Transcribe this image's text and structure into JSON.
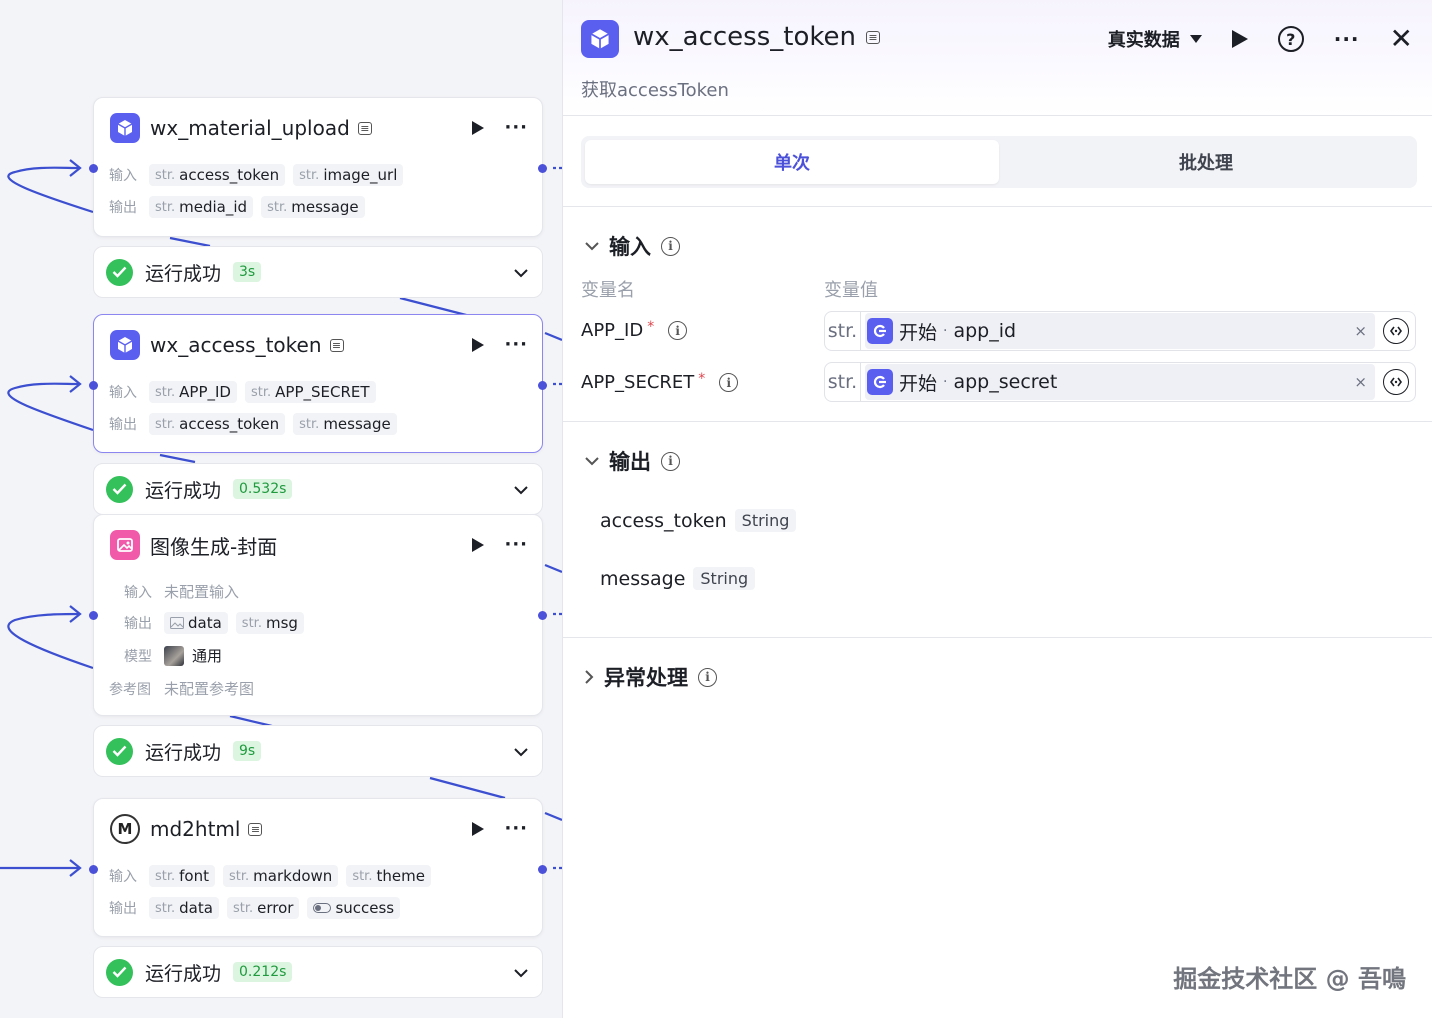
{
  "canvas": {
    "nodes": [
      {
        "title": "wx_material_upload",
        "input_label": "输入",
        "inputs": [
          {
            "type": "str.",
            "name": "access_token"
          },
          {
            "type": "str.",
            "name": "image_url"
          }
        ],
        "output_label": "输出",
        "outputs": [
          {
            "type": "str.",
            "name": "media_id"
          },
          {
            "type": "str.",
            "name": "message"
          }
        ],
        "status": "运行成功",
        "time": "3s"
      },
      {
        "title": "wx_access_token",
        "input_label": "输入",
        "inputs": [
          {
            "type": "str.",
            "name": "APP_ID"
          },
          {
            "type": "str.",
            "name": "APP_SECRET"
          }
        ],
        "output_label": "输出",
        "outputs": [
          {
            "type": "str.",
            "name": "access_token"
          },
          {
            "type": "str.",
            "name": "message"
          }
        ],
        "status": "运行成功",
        "time": "0.532s"
      },
      {
        "title": "图像生成-封面",
        "input_label": "输入",
        "input_value": "未配置输入",
        "output_label": "输出",
        "outputs": [
          {
            "type": "image",
            "name": "data"
          },
          {
            "type": "str.",
            "name": "msg"
          }
        ],
        "model_label": "模型",
        "model_value": "通用",
        "ref_label": "参考图",
        "ref_value": "未配置参考图",
        "status": "运行成功",
        "time": "9s"
      },
      {
        "title": "md2html",
        "input_label": "输入",
        "inputs": [
          {
            "type": "str.",
            "name": "font"
          },
          {
            "type": "str.",
            "name": "markdown"
          },
          {
            "type": "str.",
            "name": "theme"
          }
        ],
        "output_label": "输出",
        "outputs": [
          {
            "type": "str.",
            "name": "data"
          },
          {
            "type": "str.",
            "name": "error"
          },
          {
            "type": "bool",
            "name": "success"
          }
        ],
        "status": "运行成功",
        "time": "0.212s"
      }
    ]
  },
  "panel": {
    "title": "wx_access_token",
    "description": "获取accessToken",
    "dataset_label": "真实数据",
    "tabs": [
      "单次",
      "批处理"
    ],
    "input_section": {
      "title": "输入",
      "col_name": "变量名",
      "col_value": "变量值",
      "vars": [
        {
          "name": "APP_ID",
          "required": "*",
          "type": "str.",
          "source": "开始",
          "dot": "·",
          "ref": "app_id",
          "clear": "×"
        },
        {
          "name": "APP_SECRET",
          "required": "*",
          "type": "str.",
          "source": "开始",
          "dot": "·",
          "ref": "app_secret",
          "clear": "×"
        }
      ]
    },
    "output_section": {
      "title": "输出",
      "vars": [
        {
          "name": "access_token",
          "type": "String"
        },
        {
          "name": "message",
          "type": "String"
        }
      ]
    },
    "exception_section": {
      "title": "异常处理"
    }
  },
  "watermark": "掘金技术社区 @ 吾鳴",
  "colors": {
    "accent": "#4c51d9",
    "node_icon": "#5b5ff0",
    "success": "#34c05a",
    "success_badge_bg": "#dcf5e1",
    "wire": "#3c4fd0"
  }
}
